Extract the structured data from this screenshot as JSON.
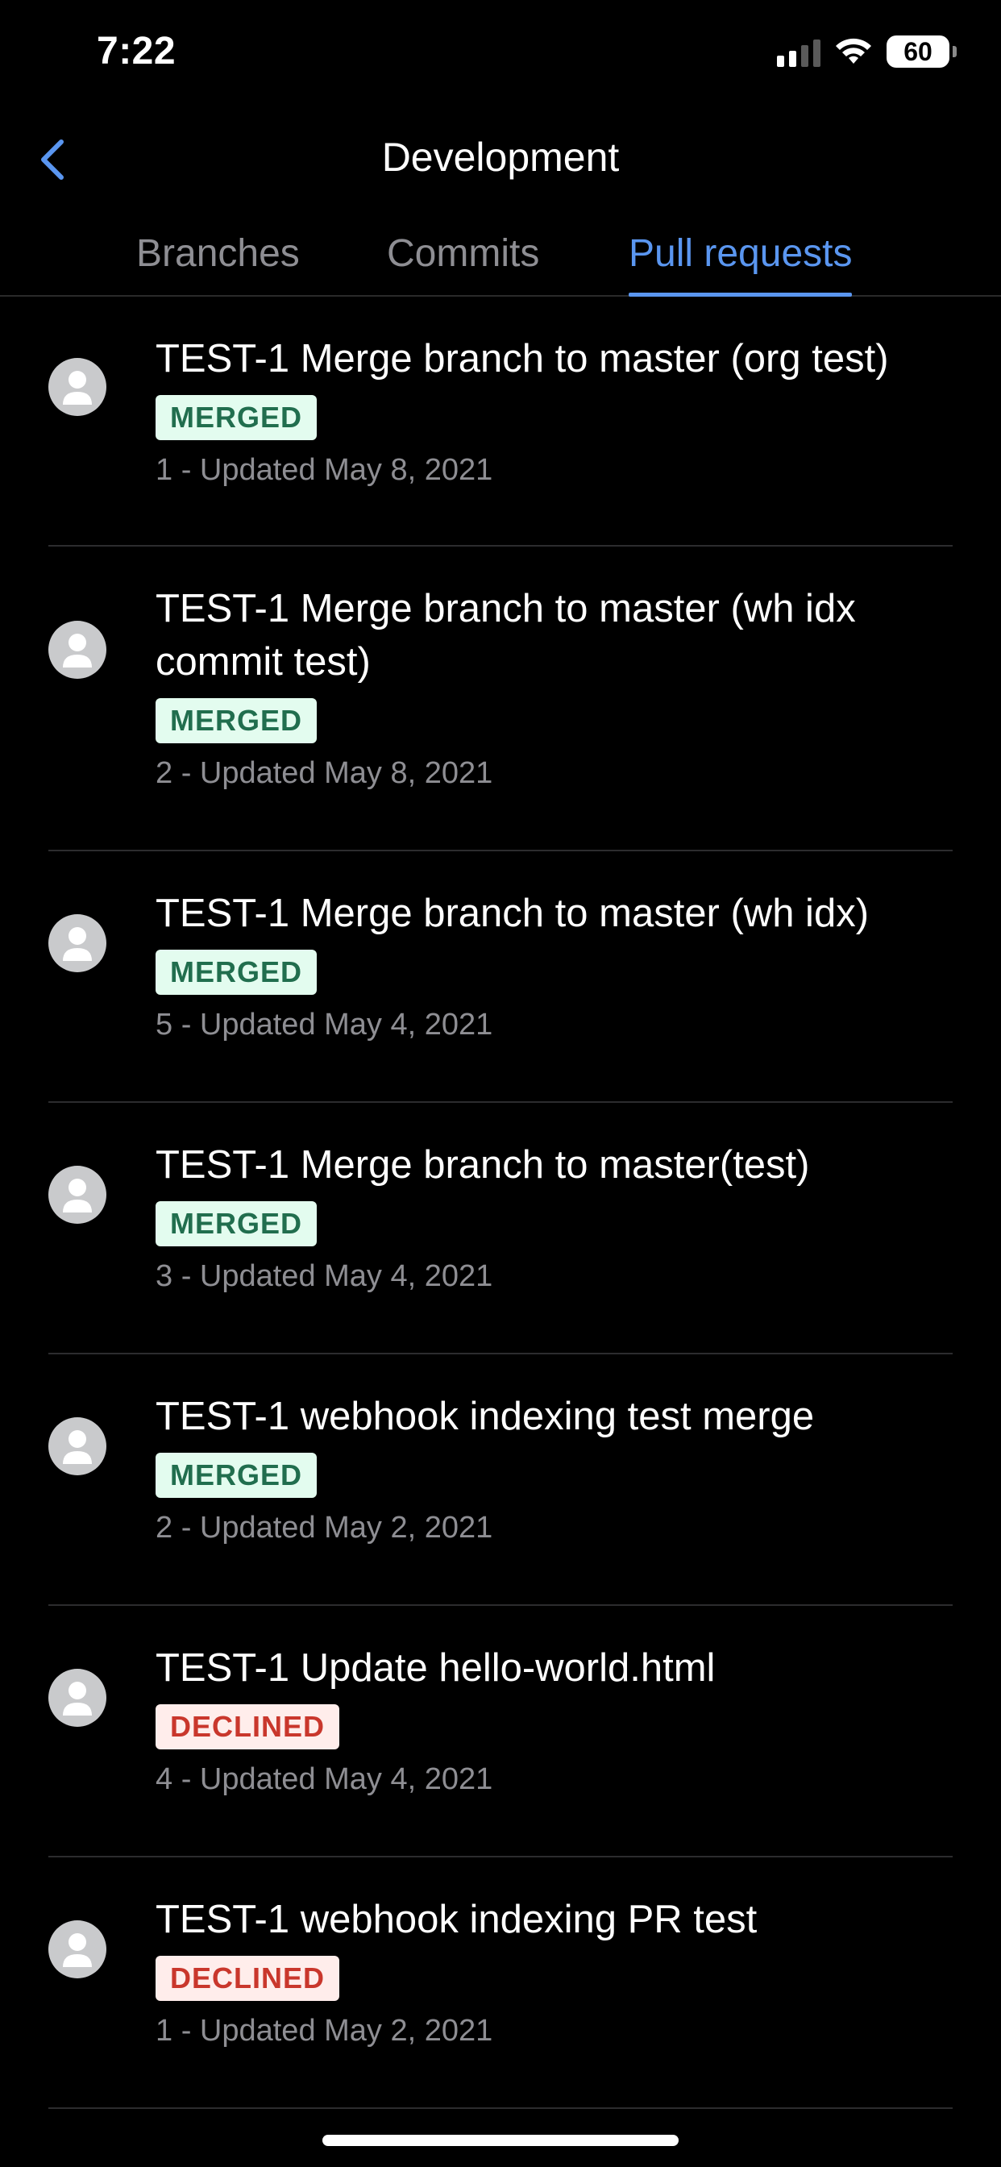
{
  "status_bar": {
    "time": "7:22",
    "battery": "60"
  },
  "nav": {
    "title": "Development"
  },
  "tabs": [
    {
      "label": "Branches",
      "active": false
    },
    {
      "label": "Commits",
      "active": false
    },
    {
      "label": "Pull requests",
      "active": true
    }
  ],
  "pull_requests": [
    {
      "title": "TEST-1 Merge branch to master (org test)",
      "status": "MERGED",
      "meta": "1 - Updated May 8, 2021"
    },
    {
      "title": "TEST-1 Merge branch to master (wh idx commit test)",
      "status": "MERGED",
      "meta": "2 - Updated May 8, 2021"
    },
    {
      "title": "TEST-1 Merge branch to master (wh idx)",
      "status": "MERGED",
      "meta": "5 - Updated May 4, 2021"
    },
    {
      "title": "TEST-1 Merge branch to master(test)",
      "status": "MERGED",
      "meta": "3 - Updated May 4, 2021"
    },
    {
      "title": "TEST-1 webhook indexing test merge",
      "status": "MERGED",
      "meta": "2 - Updated May 2, 2021"
    },
    {
      "title": "TEST-1 Update hello-world.html",
      "status": "DECLINED",
      "meta": "4 - Updated May 4, 2021"
    },
    {
      "title": "TEST-1 webhook indexing PR test",
      "status": "DECLINED",
      "meta": "1 - Updated May 2, 2021"
    }
  ],
  "colors": {
    "accent": "#5a96f0",
    "merged_bg": "#e3fcef",
    "merged_fg": "#216e4e",
    "declined_bg": "#ffedeb",
    "declined_fg": "#c9372c"
  },
  "icons": {
    "back": "chevron-left-icon",
    "avatar": "default-user-avatar-icon"
  }
}
